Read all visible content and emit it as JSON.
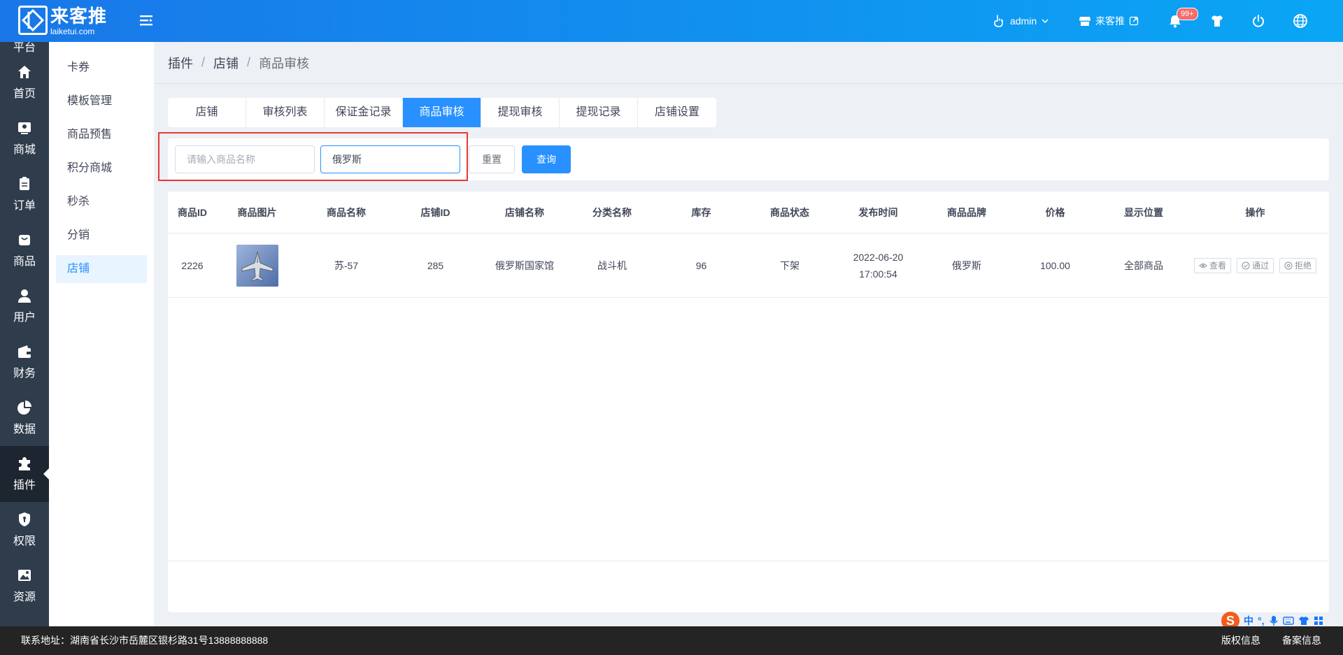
{
  "header": {
    "logo_title": "来客推",
    "logo_sub": "laiketui.com",
    "user_name": "admin",
    "store_name": "来客推",
    "notification_count": "99+"
  },
  "sidebar": {
    "items": [
      {
        "label": "平台",
        "icon": "platform-icon"
      },
      {
        "label": "首页",
        "icon": "home-icon"
      },
      {
        "label": "商城",
        "icon": "mall-icon"
      },
      {
        "label": "订单",
        "icon": "order-icon"
      },
      {
        "label": "商品",
        "icon": "product-icon"
      },
      {
        "label": "用户",
        "icon": "user-icon"
      },
      {
        "label": "财务",
        "icon": "wallet-icon"
      },
      {
        "label": "数据",
        "icon": "pie-chart-icon"
      },
      {
        "label": "插件",
        "icon": "puzzle-icon"
      },
      {
        "label": "权限",
        "icon": "shield-icon"
      },
      {
        "label": "资源",
        "icon": "image-icon"
      }
    ],
    "active": "插件"
  },
  "submenu": {
    "items": [
      "卡券",
      "模板管理",
      "商品预售",
      "积分商城",
      "秒杀",
      "分销",
      "店铺"
    ],
    "active": "店铺"
  },
  "breadcrumb": [
    "插件",
    "店铺",
    "商品审核"
  ],
  "tabs": [
    "店铺",
    "审核列表",
    "保证金记录",
    "商品审核",
    "提现审核",
    "提现记录",
    "店铺设置"
  ],
  "active_tab": "商品审核",
  "filter": {
    "name_placeholder": "请输入商品名称",
    "name_value": "",
    "store_value": "俄罗斯",
    "reset_label": "重置",
    "query_label": "查询"
  },
  "table": {
    "headers": [
      "商品ID",
      "商品图片",
      "商品名称",
      "店铺ID",
      "店铺名称",
      "分类名称",
      "库存",
      "商品状态",
      "发布时间",
      "商品品牌",
      "价格",
      "显示位置",
      "操作"
    ],
    "rows": [
      {
        "id": "2226",
        "name": "苏-57",
        "store_id": "285",
        "store_name": "俄罗斯国家馆",
        "category": "战斗机",
        "stock": "96",
        "status": "下架",
        "time": "2022-06-20 17:00:54",
        "brand": "俄罗斯",
        "price": "100.00",
        "position": "全部商品",
        "ops": [
          "查看",
          "通过",
          "拒绝"
        ]
      }
    ]
  },
  "footer": {
    "address": "联系地址：湖南省长沙市岳麓区银杉路31号13888888888",
    "links": [
      "版权信息",
      "备案信息"
    ]
  },
  "ime": {
    "logo": "S",
    "lang": "中",
    "punct": "°,"
  },
  "colors": {
    "primary": "#2890ff",
    "sidebar_bg": "#2f3c4c",
    "header_gradient_start": "#1977e8",
    "header_gradient_end": "#0aa6f5",
    "highlight": "#e53935",
    "badge": "#f56c6c"
  }
}
